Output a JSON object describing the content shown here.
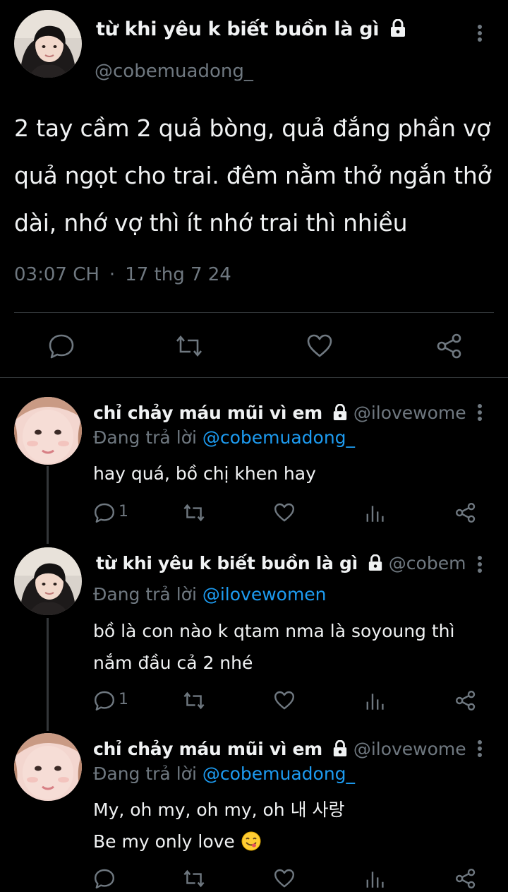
{
  "main_tweet": {
    "display_name": "từ khi yêu k biết buồn là gì",
    "handle": "@cobemuadong_",
    "text": "2 tay cầm 2 quả bòng, quả đắng phần vợ quả ngọt cho trai. đêm nằm thở ngắn thở dài, nhớ vợ thì ít nhớ trai thì nhiều",
    "time": "03:07 CH",
    "separator": "·",
    "date": "17 thg 7 24",
    "actions": [
      "reply-icon",
      "retweet-icon",
      "like-icon",
      "share-icon"
    ]
  },
  "replies": [
    {
      "display_name": "chỉ chảy máu mũi vì em",
      "handle": "@ilovewome...",
      "replying_prefix": "Đang trả lời",
      "replying_to": "@cobemuadong_",
      "lines": [
        "hay quá, bồ chị khen hay"
      ],
      "reply_count": "1"
    },
    {
      "display_name": "từ khi yêu k biết buồn là gì",
      "handle": "@cobem...",
      "replying_prefix": "Đang trả lời",
      "replying_to": "@ilovewomen",
      "lines": [
        "bồ là con nào k qtam nma là soyoung thì",
        "nắm đầu cả 2 nhé"
      ],
      "reply_count": "1"
    },
    {
      "display_name": "chỉ chảy máu mũi vì em",
      "handle": "@ilovewome...",
      "replying_prefix": "Đang trả lời",
      "replying_to": "@cobemuadong_",
      "lines": [
        "My, oh my, oh my, oh 내 사랑",
        "Be my only love"
      ],
      "emoji": "😋",
      "reply_count": ""
    }
  ],
  "colors": {
    "background": "#000000",
    "text": "#f0f2f3",
    "muted": "#6f7880",
    "link": "#1d9bf0",
    "divider": "#2f3336"
  }
}
